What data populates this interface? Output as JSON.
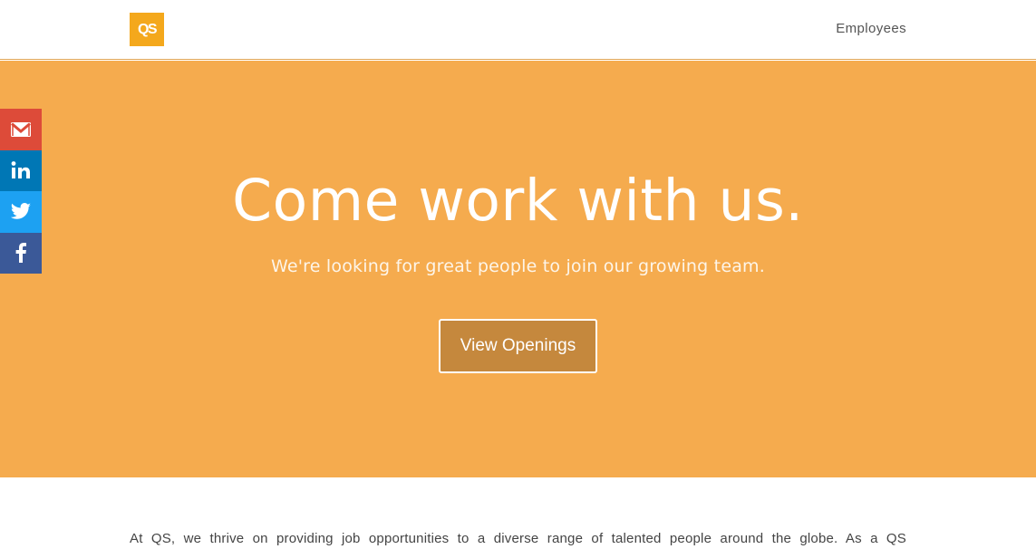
{
  "header": {
    "logo_text": "QS",
    "nav": {
      "employees_label": "Employees"
    }
  },
  "social": {
    "items": [
      {
        "name": "gmail",
        "icon": "gmail-icon",
        "color": "#dd4b39"
      },
      {
        "name": "linkedin",
        "icon": "linkedin-icon",
        "color": "#0077b5"
      },
      {
        "name": "twitter",
        "icon": "twitter-icon",
        "color": "#1da1f2"
      },
      {
        "name": "facebook",
        "icon": "facebook-icon",
        "color": "#3b5998"
      }
    ]
  },
  "hero": {
    "title": "Come work with us.",
    "subtitle": "We're looking for great people to join our growing team.",
    "cta_label": "View Openings",
    "background": "#f5ab4e",
    "button_color": "#c5883d"
  },
  "content": {
    "intro": "At QS, we thrive on providing job opportunities to a diverse range of talented people around the globe. As a QS"
  },
  "colors": {
    "brand": "#f4a81c"
  }
}
